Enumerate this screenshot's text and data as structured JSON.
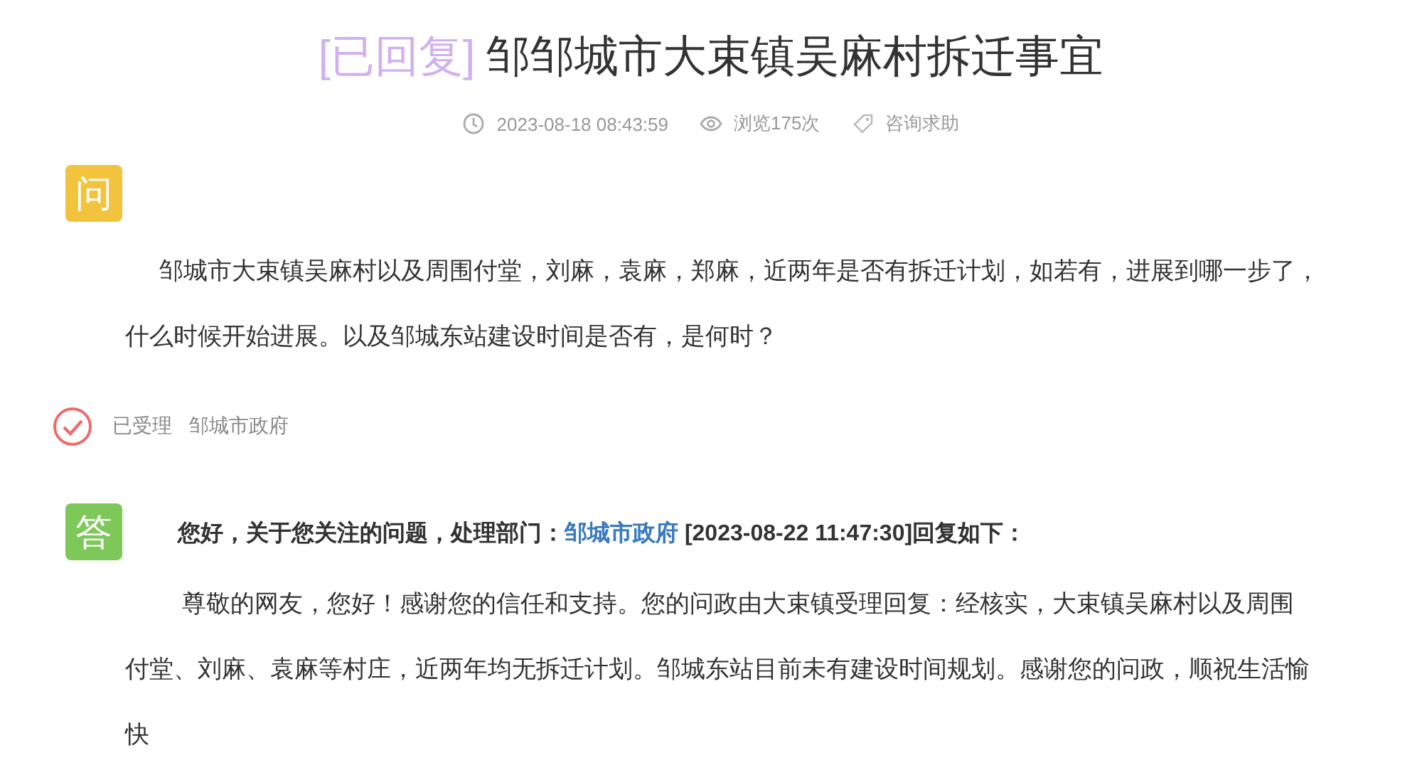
{
  "title": {
    "status": "[已回复]",
    "text": "邹邹城市大束镇吴麻村拆迁事宜"
  },
  "meta": {
    "date": "2023-08-18 08:43:59",
    "views": "浏览175次",
    "category": "咨询求助"
  },
  "question": {
    "badge": "问",
    "text": "邹城市大束镇吴麻村以及周围付堂，刘麻，袁麻，郑麻，近两年是否有拆迁计划，如若有，进展到哪一步了，什么时候开始进展。以及邹城东站建设时间是否有，是何时？"
  },
  "status": {
    "accepted": true,
    "label": "已受理",
    "department": "邹城市政府"
  },
  "answer": {
    "badge": "答",
    "intro": "您好，关于您关注的问题，处理部门：",
    "department": "邹城市政府",
    "time": "[2023-08-22 11:47:30]回复如下：",
    "text": "尊敬的网友，您好！感谢您的信任和支持。您的问政由大束镇受理回复：经核实，大束镇吴麻村以及周围付堂、刘麻、袁麻等村庄，近两年均无拆迁计划。邹城东站目前未有建设时间规划。感谢您的问政，顺祝生活愉快"
  }
}
